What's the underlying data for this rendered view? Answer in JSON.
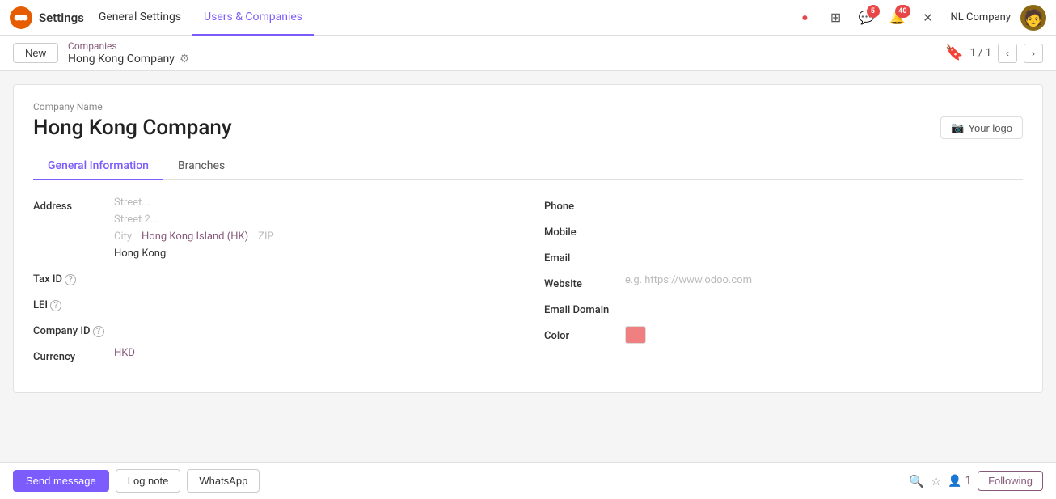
{
  "navbar": {
    "brand": "Settings",
    "menu": [
      {
        "label": "Settings",
        "active": false
      },
      {
        "label": "General Settings",
        "active": false
      },
      {
        "label": "Users & Companies",
        "active": true
      }
    ],
    "icons": {
      "dot_red": "●",
      "grid": "⊞",
      "chat_badge": "5",
      "bell_badge": "40",
      "tools": "✕"
    },
    "company_name": "NL Company"
  },
  "breadcrumb": {
    "new_label": "New",
    "parent_label": "Companies",
    "current_label": "Hong Kong Company",
    "pager": "1 / 1"
  },
  "form": {
    "company_name_label": "Company Name",
    "company_name": "Hong Kong Company",
    "logo_btn": "Your logo",
    "tabs": [
      {
        "label": "General Information",
        "active": true
      },
      {
        "label": "Branches",
        "active": false
      }
    ],
    "address": {
      "label": "Address",
      "street_placeholder": "Street...",
      "street2_placeholder": "Street 2...",
      "city_placeholder": "City",
      "city_value": "Hong Kong Island (HK)",
      "zip_placeholder": "ZIP",
      "country": "Hong Kong"
    },
    "tax_id": {
      "label": "Tax ID",
      "value": ""
    },
    "lei": {
      "label": "LEI",
      "value": ""
    },
    "company_id": {
      "label": "Company ID",
      "value": ""
    },
    "currency": {
      "label": "Currency",
      "value": "HKD"
    },
    "phone": {
      "label": "Phone",
      "value": ""
    },
    "mobile": {
      "label": "Mobile",
      "value": ""
    },
    "email": {
      "label": "Email",
      "value": ""
    },
    "website": {
      "label": "Website",
      "placeholder": "e.g. https://www.odoo.com",
      "value": ""
    },
    "email_domain": {
      "label": "Email Domain",
      "value": ""
    },
    "color": {
      "label": "Color",
      "value": "#f08080"
    }
  },
  "bottom_bar": {
    "send_message": "Send message",
    "log_note": "Log note",
    "whatsapp": "WhatsApp",
    "followers": "1",
    "following": "Following"
  }
}
